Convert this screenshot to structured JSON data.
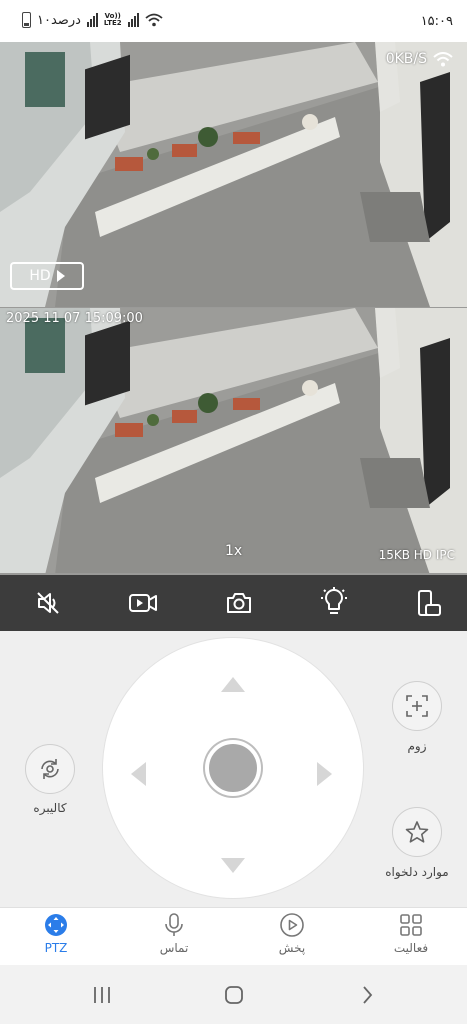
{
  "status_bar": {
    "time": "۱۵:۰۹",
    "battery_text": "۱۰درصد",
    "volte_line1": "Vo))",
    "volte_line2": "LTE2"
  },
  "video": {
    "speed": "0KB/S",
    "hd_label": "HD",
    "timestamp": "2025 11 07 15:09:00",
    "zoom_level": "1x",
    "bitrate": "15KB HD IPC"
  },
  "toolbar": {
    "icons": [
      "mute-icon",
      "record-icon",
      "snapshot-icon",
      "light-icon",
      "rotate-screen-icon"
    ]
  },
  "controls": {
    "calibrate_label": "کالیبره",
    "zoom_label": "زوم",
    "favorites_label": "موارد دلخواه"
  },
  "bottom_nav": {
    "ptz_label": "PTZ",
    "call_label": "تماس",
    "playback_label": "پخش",
    "activity_label": "فعالیت"
  },
  "colors": {
    "accent": "#2b7de9",
    "toolbar_bg": "#3c3c3c",
    "panel_bg": "#efefef"
  }
}
